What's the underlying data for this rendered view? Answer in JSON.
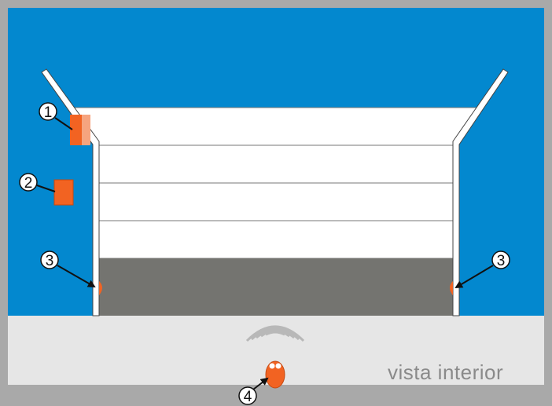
{
  "caption": "vista interior",
  "callouts": [
    {
      "number": "1",
      "component": "wall control box (upper)"
    },
    {
      "number": "2",
      "component": "wall control box (lower)"
    },
    {
      "number": "3",
      "component": "left photocell"
    },
    {
      "number": "3",
      "component": "right photocell"
    },
    {
      "number": "4",
      "component": "remote transmitter"
    }
  ],
  "colors": {
    "wall": "#0388cf",
    "floor": "#e6e6e6",
    "frame_bg": "#a9a9a9",
    "door_panel": "#ffffff",
    "door_bottom": "#747470",
    "component": "#f26322",
    "component_light": "#f6a47f",
    "signal_waves": "#b8b8b8"
  }
}
